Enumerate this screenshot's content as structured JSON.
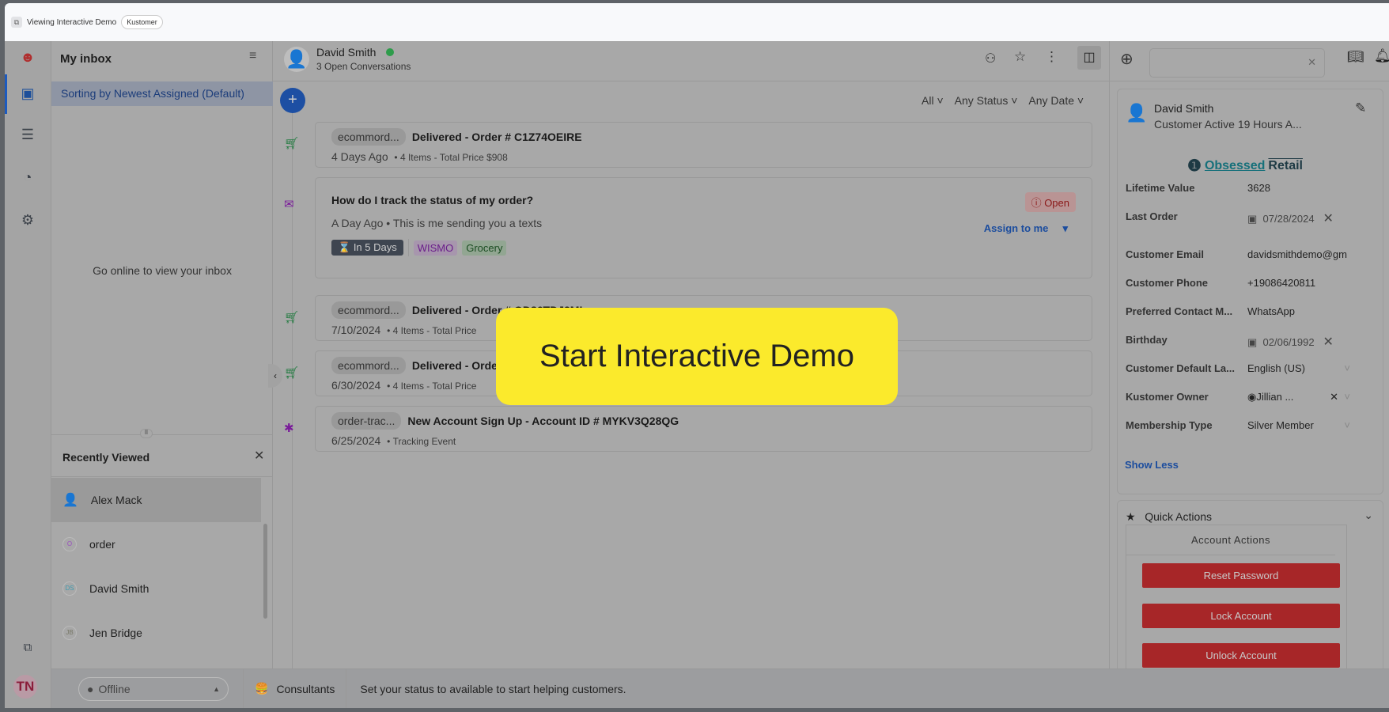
{
  "topbar": {
    "title": "Viewing Interactive Demo",
    "badge": "Kustomer"
  },
  "rail": {
    "icons": [
      "kustomer-logo-icon",
      "inbox-icon",
      "search-list-icon",
      "reports-icon",
      "settings-icon",
      "windows-icon"
    ],
    "avatar": "TN"
  },
  "inbox": {
    "title": "My inbox",
    "sorting": "Sorting by Newest Assigned (Default)",
    "empty": "Go online to view your inbox"
  },
  "recent": {
    "title": "Recently Viewed",
    "items": [
      {
        "name": "Alex Mack",
        "initials": ""
      },
      {
        "name": "order",
        "initials": "O"
      },
      {
        "name": "David Smith",
        "initials": "DS"
      },
      {
        "name": "Jen Bridge",
        "initials": "JB"
      }
    ]
  },
  "bottombar": {
    "status": "Offline",
    "team": "Consultants",
    "message": "Set your status to available to start helping customers."
  },
  "header": {
    "name": "David Smith",
    "subtitle": "3 Open Conversations",
    "online_color": "#2e9c4b"
  },
  "filters": {
    "all": "All",
    "status": "Any Status",
    "date": "Any Date"
  },
  "timeline": [
    {
      "icon": "cart-icon",
      "chip": "ecommord...",
      "title": "Delivered - Order # C1Z74OEIRE",
      "date": "4 Days Ago",
      "detail": "4 Items - Total Price $908"
    },
    {
      "icon": "email-icon",
      "title": "How do I track the status of my order?",
      "status": "Open",
      "date": "A Day Ago",
      "detail": "This is me sending you a texts",
      "assign": "Assign to me",
      "sla": "In 5 Days",
      "tags": [
        "WISMO",
        "Grocery"
      ]
    },
    {
      "icon": "cart-icon",
      "chip": "ecommord...",
      "title": "Delivered - Order # OD86TDJ2ML",
      "date": "7/10/2024",
      "detail": "4 Items - Total Price"
    },
    {
      "icon": "cart-icon",
      "chip": "ecommord...",
      "title": "Delivered - Order",
      "date": "6/30/2024",
      "detail": "4 Items - Total Price"
    },
    {
      "icon": "click-icon",
      "chip": "order-trac...",
      "title": "New Account Sign Up - Account ID # MYKV3Q28QG",
      "date": "6/25/2024",
      "detail": "Tracking Event"
    }
  ],
  "overlay": {
    "label": "Start Interactive Demo",
    "color": "#fbea2c"
  },
  "customer": {
    "name": "David Smith",
    "activity": "Customer Active 19 Hours A...",
    "brand1": "Obsessed",
    "brand2": "Retail",
    "fields": [
      {
        "label": "Lifetime Value",
        "value": "3628"
      },
      {
        "label": "Last Order",
        "value": "07/28/2024"
      },
      {
        "label": "Customer Email",
        "value": "davidsmithdemo@gm"
      },
      {
        "label": "Customer Phone",
        "value": "+19086420811"
      },
      {
        "label": "Preferred Contact M...",
        "value": "WhatsApp"
      },
      {
        "label": "Birthday",
        "value": "02/06/1992"
      },
      {
        "label": "Customer Default La...",
        "value": "English (US)"
      },
      {
        "label": "Kustomer Owner",
        "value": "Jillian ..."
      },
      {
        "label": "Membership Type",
        "value": "Silver Member"
      }
    ],
    "show_less": "Show Less"
  },
  "quick": {
    "title": "Quick Actions",
    "section": "Account Actions",
    "buttons": [
      "Reset Password",
      "Lock Account",
      "Unlock Account"
    ]
  }
}
